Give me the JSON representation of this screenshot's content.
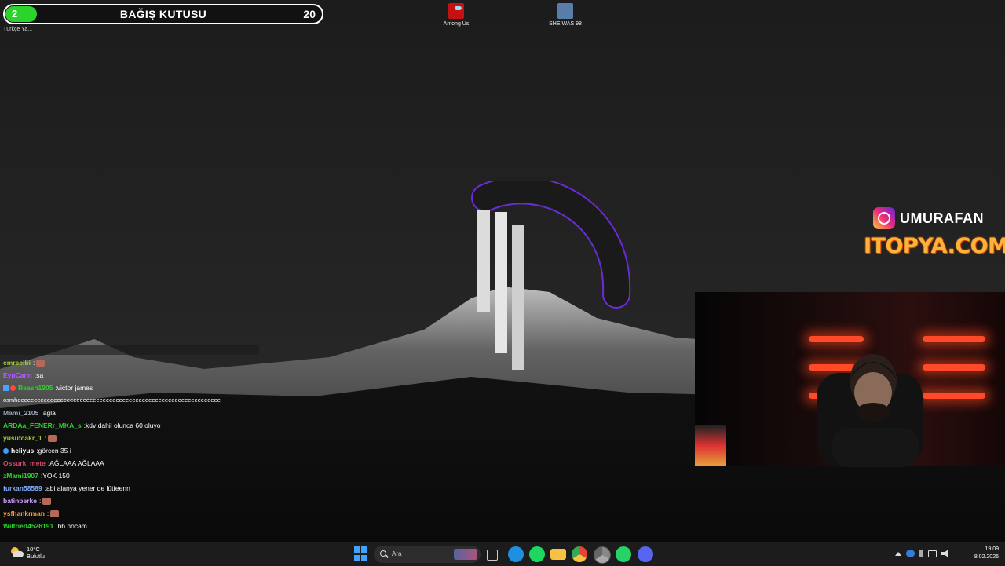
{
  "donation": {
    "badge": "2",
    "title": "BAĞIŞ KUTUSU",
    "count": "20",
    "fill_fraction": 0.1
  },
  "desktop": {
    "shortcut_label": "Türkçe Ya...",
    "icons": [
      {
        "label": "Among Us",
        "icon": "among-us-icon"
      },
      {
        "label": "SHE WAS 98",
        "icon": "she-was-98-icon"
      }
    ]
  },
  "branding": {
    "instagram_handle": "UMURAFAN",
    "sponsor": "ITOPYA.COM",
    "instagram_icon": "instagram-icon"
  },
  "chat": {
    "messages": [
      {
        "user": "emrecibi",
        "color": "#9acd32",
        "text": "",
        "emote": true
      },
      {
        "user": "EypCann",
        "color": "#b45cff",
        "text": "sa"
      },
      {
        "user": "Reash1905",
        "color": "#2bd42b",
        "text": "victor james",
        "badges": true
      },
      {
        "user": "",
        "color": "#ffffff",
        "text": "osmheeeeeeeeeeeeeeeeeeeeeeeeeeeeeeeeeeeeeeeeeeeeeeeeeeeeeeeeeeeeee"
      },
      {
        "user": "Mami_2105",
        "color": "#9aa6b8",
        "text": "ağla"
      },
      {
        "user": "ARDAa_FENERr_MKA_s",
        "color": "#2bd42b",
        "text": "kdv dahil olunca 60 oluyo"
      },
      {
        "user": "yusufcakr_1",
        "color": "#9acd32",
        "text": "",
        "emote": true
      },
      {
        "user": "heliyus",
        "color": "#ffffff",
        "text": "görcen 35 i",
        "dot": true
      },
      {
        "user": "Ossurk_mete",
        "color": "#d2496b",
        "text": "AĞLAAA AĞLAAA"
      },
      {
        "user": "zMami1907",
        "color": "#2bd42b",
        "text": "YOK 150"
      },
      {
        "user": "furkan58589",
        "color": "#7fb0ff",
        "text": "abi alanya yener de lütfeenn"
      },
      {
        "user": "batinberke",
        "color": "#c9a0ff",
        "text": "",
        "emote": true
      },
      {
        "user": "ysfhankrman",
        "color": "#ff9a3a",
        "text": "",
        "emote": true
      },
      {
        "user": "Wilfried4526191",
        "color": "#2bd42b",
        "text": "hb hocam"
      }
    ]
  },
  "taskbar": {
    "weather_temp": "10°C",
    "weather_desc": "Bulutlu",
    "search_placeholder": "Ara",
    "time": "19:09",
    "date": "8.02.2026",
    "pinned": [
      "start-icon",
      "task-view-icon",
      "edge-icon",
      "spotify-icon",
      "file-explorer-icon",
      "chrome-icon",
      "chrome-alt-icon",
      "whatsapp-icon",
      "discord-icon"
    ],
    "colors": {
      "edge": "#1f8fe0",
      "spotify": "#1ed760",
      "explorer": "#f5c242",
      "chrome": "#e84335",
      "whatsapp": "#25d366",
      "discord": "#5865f2"
    }
  }
}
